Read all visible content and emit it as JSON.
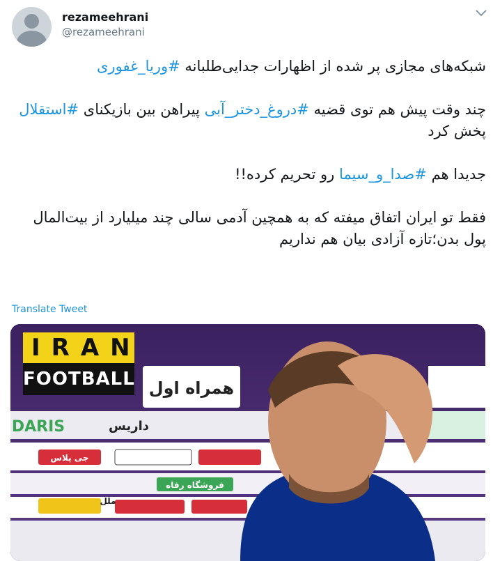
{
  "author": {
    "display_name": "rezameehrani",
    "handle": "@rezameehrani",
    "avatar_icon": "default-avatar-icon"
  },
  "menu_icon": "chevron-down-icon",
  "tweet": {
    "p1": {
      "text": "شبکه‌های مجازی پر شده از اظهارات جدایی‌طلبانه ",
      "tag": "#وریا_غفوری"
    },
    "p2": {
      "t1": "چند وقت پیش هم توی قضیه ",
      "tag1": "#دروغ_دختر_آبی",
      "t2": " پیراهن بین بازیکنای ",
      "tag2": "#استقلال",
      "t3": " پخش کرد"
    },
    "p3": {
      "t1": "جدیدا هم ",
      "tag": "#صدا_و_سیما",
      "t2": " رو تحریم کرده!!"
    },
    "p4": {
      "text": "فقط تو ایران اتفاق میفته که به همچین آدمی سالی چند میلیارد از بیت‌المال پول بدن؛تازه آزادی بیان هم نداریم"
    }
  },
  "translate_label": "Translate Tweet",
  "media": {
    "logo_line1": "IRAN",
    "logo_line2": "FOOTBALL",
    "board_text_1": "همراه اول",
    "board_text_2": "داریس",
    "board_text_3": "DARIS",
    "board_text_4": "فروشگاه رفاه",
    "board_text_5": "ملل",
    "board_text_6": "جی پلاس",
    "colors": {
      "board_bg": "#5b3a86",
      "board_red": "#d62f3a",
      "logo_yellow": "#f3d31a",
      "hashtag": "#1b95e0"
    }
  }
}
